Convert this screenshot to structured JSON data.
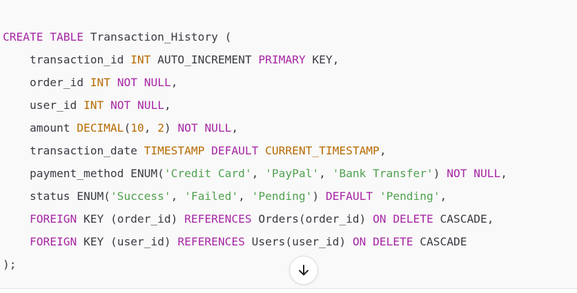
{
  "code": {
    "language": "sql",
    "lines": [
      [
        [
          "k",
          "CREATE"
        ],
        [
          "p",
          " "
        ],
        [
          "k",
          "TABLE"
        ],
        [
          "p",
          " Transaction_History ("
        ]
      ],
      [
        [
          "p",
          "    transaction_id "
        ],
        [
          "t",
          "INT"
        ],
        [
          "p",
          " AUTO_INCREMENT "
        ],
        [
          "k",
          "PRIMARY"
        ],
        [
          "p",
          " KEY,"
        ]
      ],
      [
        [
          "p",
          "    order_id "
        ],
        [
          "t",
          "INT"
        ],
        [
          "p",
          " "
        ],
        [
          "k",
          "NOT"
        ],
        [
          "p",
          " "
        ],
        [
          "k",
          "NULL"
        ],
        [
          "p",
          ","
        ]
      ],
      [
        [
          "p",
          "    user_id "
        ],
        [
          "t",
          "INT"
        ],
        [
          "p",
          " "
        ],
        [
          "k",
          "NOT"
        ],
        [
          "p",
          " "
        ],
        [
          "k",
          "NULL"
        ],
        [
          "p",
          ","
        ]
      ],
      [
        [
          "p",
          "    amount "
        ],
        [
          "t",
          "DECIMAL"
        ],
        [
          "p",
          "("
        ],
        [
          "n",
          "10"
        ],
        [
          "p",
          ", "
        ],
        [
          "n",
          "2"
        ],
        [
          "p",
          ") "
        ],
        [
          "k",
          "NOT"
        ],
        [
          "p",
          " "
        ],
        [
          "k",
          "NULL"
        ],
        [
          "p",
          ","
        ]
      ],
      [
        [
          "p",
          "    transaction_date "
        ],
        [
          "t",
          "TIMESTAMP"
        ],
        [
          "p",
          " "
        ],
        [
          "k",
          "DEFAULT"
        ],
        [
          "p",
          " "
        ],
        [
          "t",
          "CURRENT_TIMESTAMP"
        ],
        [
          "p",
          ","
        ]
      ],
      [
        [
          "p",
          "    payment_method ENUM("
        ],
        [
          "s",
          "'Credit Card'"
        ],
        [
          "p",
          ", "
        ],
        [
          "s",
          "'PayPal'"
        ],
        [
          "p",
          ", "
        ],
        [
          "s",
          "'Bank Transfer'"
        ],
        [
          "p",
          ") "
        ],
        [
          "k",
          "NOT"
        ],
        [
          "p",
          " "
        ],
        [
          "k",
          "NULL"
        ],
        [
          "p",
          ","
        ]
      ],
      [
        [
          "p",
          "    status ENUM("
        ],
        [
          "s",
          "'Success'"
        ],
        [
          "p",
          ", "
        ],
        [
          "s",
          "'Failed'"
        ],
        [
          "p",
          ", "
        ],
        [
          "s",
          "'Pending'"
        ],
        [
          "p",
          ") "
        ],
        [
          "k",
          "DEFAULT"
        ],
        [
          "p",
          " "
        ],
        [
          "s",
          "'Pending'"
        ],
        [
          "p",
          ","
        ]
      ],
      [
        [
          "p",
          "    "
        ],
        [
          "k",
          "FOREIGN"
        ],
        [
          "p",
          " KEY (order_id) "
        ],
        [
          "k",
          "REFERENCES"
        ],
        [
          "p",
          " Orders(order_id) "
        ],
        [
          "k",
          "ON"
        ],
        [
          "p",
          " "
        ],
        [
          "k",
          "DELETE"
        ],
        [
          "p",
          " CASCADE,"
        ]
      ],
      [
        [
          "p",
          "    "
        ],
        [
          "k",
          "FOREIGN"
        ],
        [
          "p",
          " KEY (user_id) "
        ],
        [
          "k",
          "REFERENCES"
        ],
        [
          "p",
          " Users(user_id) "
        ],
        [
          "k",
          "ON"
        ],
        [
          "p",
          " "
        ],
        [
          "k",
          "DELETE"
        ],
        [
          "p",
          " CASCADE"
        ]
      ],
      [
        [
          "p",
          ");"
        ]
      ]
    ]
  },
  "scroll_button": {
    "icon": "arrow-down-icon"
  },
  "colors": {
    "keyword": "#a626a4",
    "type": "#b76b01",
    "string": "#50a14f",
    "plain": "#383a42",
    "background": "#f9f9f9"
  }
}
